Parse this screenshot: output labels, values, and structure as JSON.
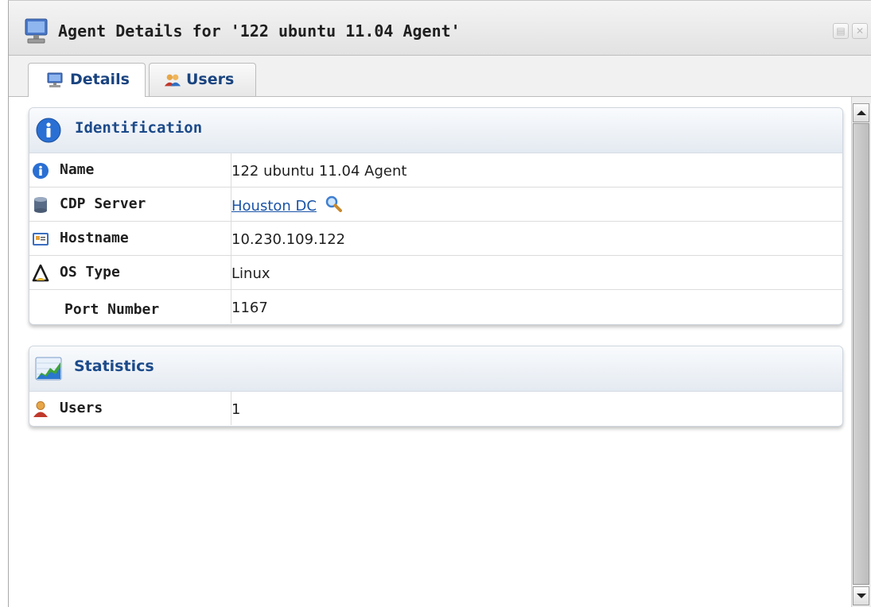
{
  "window": {
    "title": "Agent Details for '122 ubuntu 11.04 Agent'",
    "icon": "computer-icon",
    "buttons": [
      "restore-icon",
      "close-icon"
    ]
  },
  "tabs": [
    {
      "label": "Details",
      "icon": "computer-icon",
      "selected": true
    },
    {
      "label": "Users",
      "icon": "users-icon",
      "selected": false
    }
  ],
  "identification": {
    "title": "Identification",
    "icon": "info-icon",
    "rows": [
      {
        "label": "Name",
        "icon": "info-icon",
        "value": "122 ubuntu 11.04 Agent"
      },
      {
        "label": "CDP Server",
        "icon": "database-icon",
        "value": "Houston DC",
        "value_icon": "magnifier-icon"
      },
      {
        "label": "Hostname",
        "icon": "hostname-icon",
        "value": "10.230.109.122"
      },
      {
        "label": "OS Type",
        "icon": "linux-icon",
        "value": "Linux"
      },
      {
        "label": "Port Number",
        "icon": "",
        "value": "1167"
      }
    ]
  },
  "statistics": {
    "title": "Statistics",
    "icon": "chart-icon",
    "rows": [
      {
        "label": "Users",
        "icon": "user-icon",
        "value": "1"
      }
    ]
  },
  "colors": {
    "header_text": "#1c4a8a",
    "link": "#1a54a8",
    "tab_text": "#1a4480"
  }
}
